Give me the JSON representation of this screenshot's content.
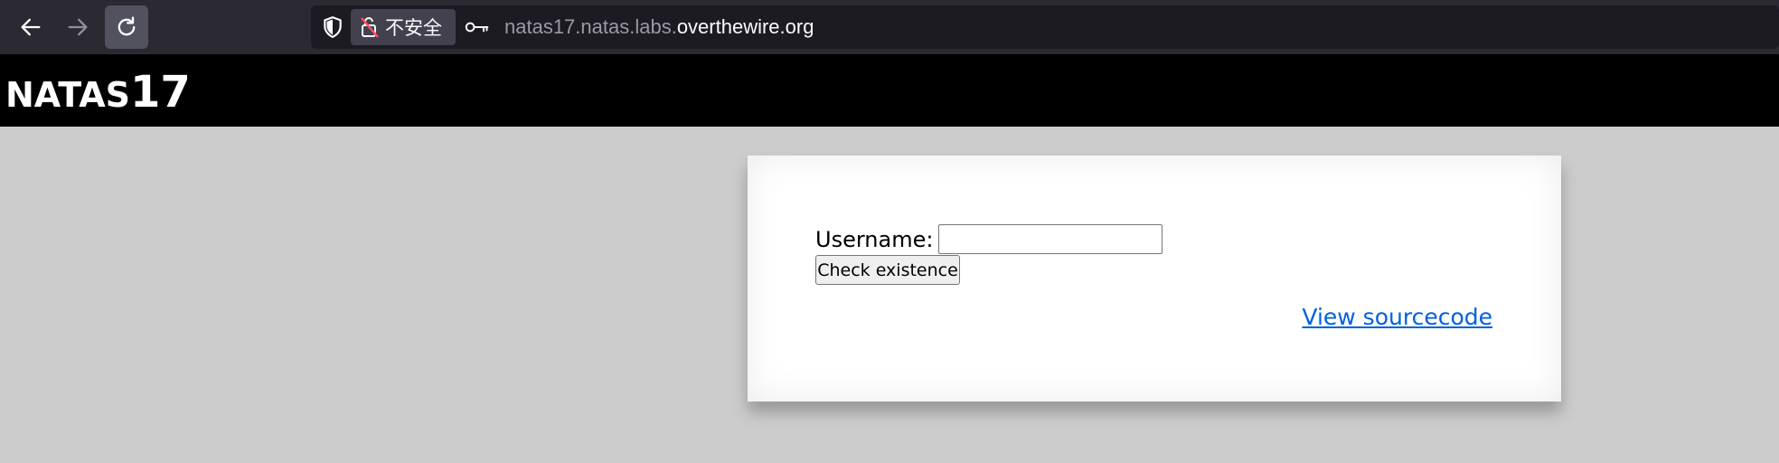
{
  "browser": {
    "security_label": "不安全",
    "url_prefix": "natas17.natas.labs.",
    "url_domain": "overthewire.org",
    "icons": [
      "back-arrow-icon",
      "forward-arrow-icon",
      "reload-icon",
      "shield-icon",
      "insecure-lock-icon",
      "key-icon"
    ]
  },
  "header": {
    "title_word": "NATAS",
    "title_number": "17"
  },
  "form": {
    "username_label": "Username:",
    "username_value": "",
    "submit_label": "Check existence"
  },
  "footer": {
    "source_link": "View sourcecode"
  },
  "colors": {
    "chrome_bg": "#2b2a33",
    "urlbar_bg": "#1c1b22",
    "header_bg": "#000000",
    "page_bg": "#cccccc",
    "link": "#0060df"
  }
}
